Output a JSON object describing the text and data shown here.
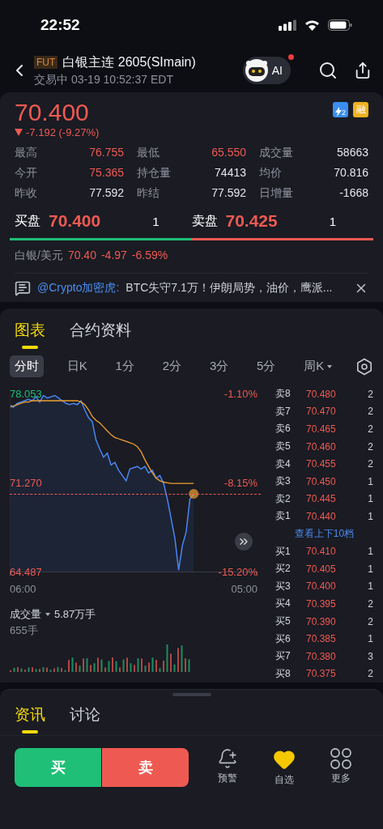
{
  "status_bar": {
    "time": "22:52"
  },
  "header": {
    "badge": "FUT",
    "title": "白银主连 2605(SImain)",
    "subtitle": "交易中 03-19 10:52:37 EDT",
    "ai_label": "AI",
    "ai_notification": true
  },
  "quote": {
    "price": "70.400",
    "change": "-7.192 (-9.27%)",
    "falling": true,
    "badges": [
      {
        "kind": "lightning",
        "text": "2"
      },
      {
        "kind": "text",
        "text": "融"
      }
    ],
    "stats": [
      {
        "label": "最高",
        "value": "76.755",
        "color": "#ee5a52"
      },
      {
        "label": "最低",
        "value": "65.550",
        "color": "#ee5a52"
      },
      {
        "label": "成交量",
        "value": "58663",
        "color": "#e6e7ec"
      },
      {
        "label": "今开",
        "value": "75.365",
        "color": "#ee5a52"
      },
      {
        "label": "持仓量",
        "value": "74413",
        "color": "#e6e7ec"
      },
      {
        "label": "均价",
        "value": "70.816",
        "color": "#e6e7ec"
      },
      {
        "label": "昨收",
        "value": "77.592",
        "color": "#e6e7ec"
      },
      {
        "label": "昨结",
        "value": "77.592",
        "color": "#e6e7ec"
      },
      {
        "label": "日增量",
        "value": "-1668",
        "color": "#e6e7ec"
      }
    ],
    "bid": {
      "label": "买盘",
      "price": "70.400",
      "qty": "1"
    },
    "ask": {
      "label": "卖盘",
      "price": "70.425",
      "qty": "1"
    },
    "bid_share": {
      "level": 0.5
    },
    "related": {
      "name": "白银/美元",
      "price": "70.40",
      "change": "-4.97",
      "percent": "-6.59%"
    }
  },
  "news_ticker": {
    "author": "@Crypto加密虎:",
    "text": "BTC失守7.1万！伊朗局势，油价，鹰派..."
  },
  "chart_tabs": [
    {
      "label": "图表",
      "selected": true
    },
    {
      "label": "合约资料",
      "selected": false
    }
  ],
  "periods": [
    {
      "label": "分时",
      "selected": true,
      "has_menu": false
    },
    {
      "label": "日K",
      "selected": false,
      "has_menu": false
    },
    {
      "label": "1分",
      "selected": false,
      "has_menu": false
    },
    {
      "label": "2分",
      "selected": false,
      "has_menu": false
    },
    {
      "label": "3分",
      "selected": false,
      "has_menu": false
    },
    {
      "label": "5分",
      "selected": false,
      "has_menu": false
    },
    {
      "label": "周K",
      "selected": false,
      "has_menu": true
    }
  ],
  "chart": {
    "pct_labels": [
      "-1.10%",
      "-8.15%",
      "-15.20%"
    ],
    "time_labels": [
      "06:00",
      "05:00"
    ],
    "chart_data": {
      "type": "line",
      "ylim": [
        64.487,
        78.053
      ],
      "yticks": [
        {
          "value": 78.053,
          "label": "78.053"
        },
        {
          "value": 71.27,
          "label": "71.270"
        },
        {
          "value": 64.487,
          "label": "64.487"
        }
      ],
      "series": [
        {
          "type": "area",
          "color": "#4a86f0",
          "values": [
            77.2,
            77.0,
            77.3,
            77.4,
            77.5,
            77.6,
            77.5,
            77.8,
            77.4,
            77.9,
            77.7,
            77.8,
            77.9,
            77.7,
            77.5,
            77.3,
            77.2,
            77.3,
            77.2,
            77.5,
            76.8,
            76.2,
            75.9,
            74.5,
            73.8,
            73.2,
            73.5,
            72.6,
            72.8,
            72.2,
            71.8,
            71.4,
            72.3,
            72.4,
            72.5,
            72.3,
            72.5,
            72.0,
            72.2,
            71.6,
            71.8,
            71.2,
            70.0,
            68.5,
            67.0,
            64.6,
            66.5,
            67.5,
            70.0,
            70.4
          ]
        },
        {
          "type": "line",
          "color": "#f0a030",
          "values": [
            77.0,
            77.1,
            77.2,
            77.3,
            77.4,
            77.4,
            77.5,
            77.5,
            77.5,
            77.5,
            77.5,
            77.5,
            77.5,
            77.5,
            77.5,
            77.5,
            77.5,
            77.5,
            77.5,
            77.4,
            77.2,
            76.8,
            76.3,
            76.0,
            75.8,
            75.5,
            75.2,
            74.9,
            74.7,
            74.6,
            74.5,
            74.4,
            74.3,
            74.2,
            74.0,
            73.6,
            73.0,
            72.5,
            72.0,
            71.6,
            71.4,
            71.3,
            71.25,
            71.2,
            71.2,
            71.2,
            71.2,
            71.2,
            71.2,
            71.2
          ]
        }
      ]
    }
  },
  "volume": {
    "label": "成交量",
    "total": "5.87万手",
    "max": "655手"
  },
  "order_book": {
    "asks": [
      {
        "label": "卖8",
        "price": "70.480",
        "qty": "2"
      },
      {
        "label": "卖7",
        "price": "70.470",
        "qty": "2"
      },
      {
        "label": "卖6",
        "price": "70.465",
        "qty": "2"
      },
      {
        "label": "卖5",
        "price": "70.460",
        "qty": "2"
      },
      {
        "label": "卖4",
        "price": "70.455",
        "qty": "2"
      },
      {
        "label": "卖3",
        "price": "70.450",
        "qty": "1"
      },
      {
        "label": "卖2",
        "price": "70.445",
        "qty": "1"
      },
      {
        "label": "卖1",
        "price": "70.440",
        "qty": "1"
      }
    ],
    "more_link": "查看上下10档",
    "bids": [
      {
        "label": "买1",
        "price": "70.410",
        "qty": "1"
      },
      {
        "label": "买2",
        "price": "70.405",
        "qty": "1"
      },
      {
        "label": "买3",
        "price": "70.400",
        "qty": "1"
      },
      {
        "label": "买4",
        "price": "70.395",
        "qty": "2"
      },
      {
        "label": "买5",
        "price": "70.390",
        "qty": "2"
      },
      {
        "label": "买6",
        "price": "70.385",
        "qty": "1"
      },
      {
        "label": "买7",
        "price": "70.380",
        "qty": "3"
      },
      {
        "label": "买8",
        "price": "70.375",
        "qty": "2"
      }
    ]
  },
  "info_tabs": [
    {
      "label": "资讯",
      "selected": true
    },
    {
      "label": "讨论",
      "selected": false
    }
  ],
  "actions": {
    "buy": "买",
    "sell": "卖",
    "tools": [
      {
        "kind": "alert",
        "label": "预警",
        "active": false
      },
      {
        "kind": "watchlist",
        "label": "自选",
        "active": true
      },
      {
        "kind": "more",
        "label": "更多",
        "active": false
      }
    ]
  }
}
